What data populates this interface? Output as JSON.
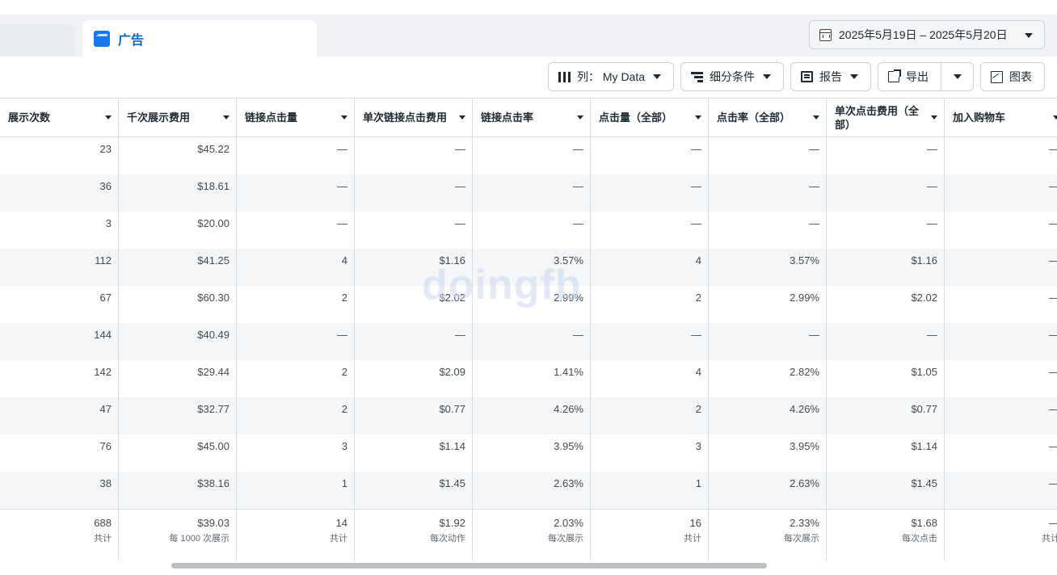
{
  "tabs": {
    "active_label": "广告"
  },
  "date_range": {
    "label": "2025年5月19日 – 2025年5月20日"
  },
  "toolbar": {
    "columns_label": "列： My Data",
    "breakdown_label": "细分条件",
    "report_label": "报告",
    "export_label": "导出",
    "chart_label": "图表"
  },
  "table": {
    "headers": [
      "展示次数",
      "千次展示费用",
      "链接点击量",
      "单次链接点击费用",
      "链接点击率",
      "点击量（全部）",
      "点击率（全部）",
      "单次点击费用（全部）",
      "加入购物车"
    ],
    "rows": [
      [
        "23",
        "$45.22",
        "—",
        "—",
        "—",
        "—",
        "—",
        "—",
        "—"
      ],
      [
        "36",
        "$18.61",
        "—",
        "—",
        "—",
        "—",
        "—",
        "—",
        "—"
      ],
      [
        "3",
        "$20.00",
        "—",
        "—",
        "—",
        "—",
        "—",
        "—",
        "—"
      ],
      [
        "112",
        "$41.25",
        "4",
        "$1.16",
        "3.57%",
        "4",
        "3.57%",
        "$1.16",
        "—"
      ],
      [
        "67",
        "$60.30",
        "2",
        "$2.02",
        "2.99%",
        "2",
        "2.99%",
        "$2.02",
        "—"
      ],
      [
        "144",
        "$40.49",
        "—",
        "—",
        "—",
        "—",
        "—",
        "—",
        "—"
      ],
      [
        "142",
        "$29.44",
        "2",
        "$2.09",
        "1.41%",
        "4",
        "2.82%",
        "$1.05",
        "—"
      ],
      [
        "47",
        "$32.77",
        "2",
        "$0.77",
        "4.26%",
        "2",
        "4.26%",
        "$0.77",
        "—"
      ],
      [
        "76",
        "$45.00",
        "3",
        "$1.14",
        "3.95%",
        "3",
        "3.95%",
        "$1.14",
        "—"
      ],
      [
        "38",
        "$38.16",
        "1",
        "$1.45",
        "2.63%",
        "1",
        "2.63%",
        "$1.45",
        "—"
      ]
    ],
    "totals": [
      {
        "value": "688",
        "sub": "共计"
      },
      {
        "value": "$39.03",
        "sub": "每 1000 次展示"
      },
      {
        "value": "14",
        "sub": "共计"
      },
      {
        "value": "$1.92",
        "sub": "每次动作"
      },
      {
        "value": "2.03%",
        "sub": "每次展示"
      },
      {
        "value": "16",
        "sub": "共计"
      },
      {
        "value": "2.33%",
        "sub": "每次展示"
      },
      {
        "value": "$1.68",
        "sub": "每次点击"
      },
      {
        "value": "—",
        "sub": "共计"
      }
    ]
  },
  "watermark": "doingfb",
  "colors": {
    "accent": "#1877f2",
    "tab_text": "#0a66c2",
    "row_alt": "#f5f6f7",
    "border": "#dadde1"
  }
}
